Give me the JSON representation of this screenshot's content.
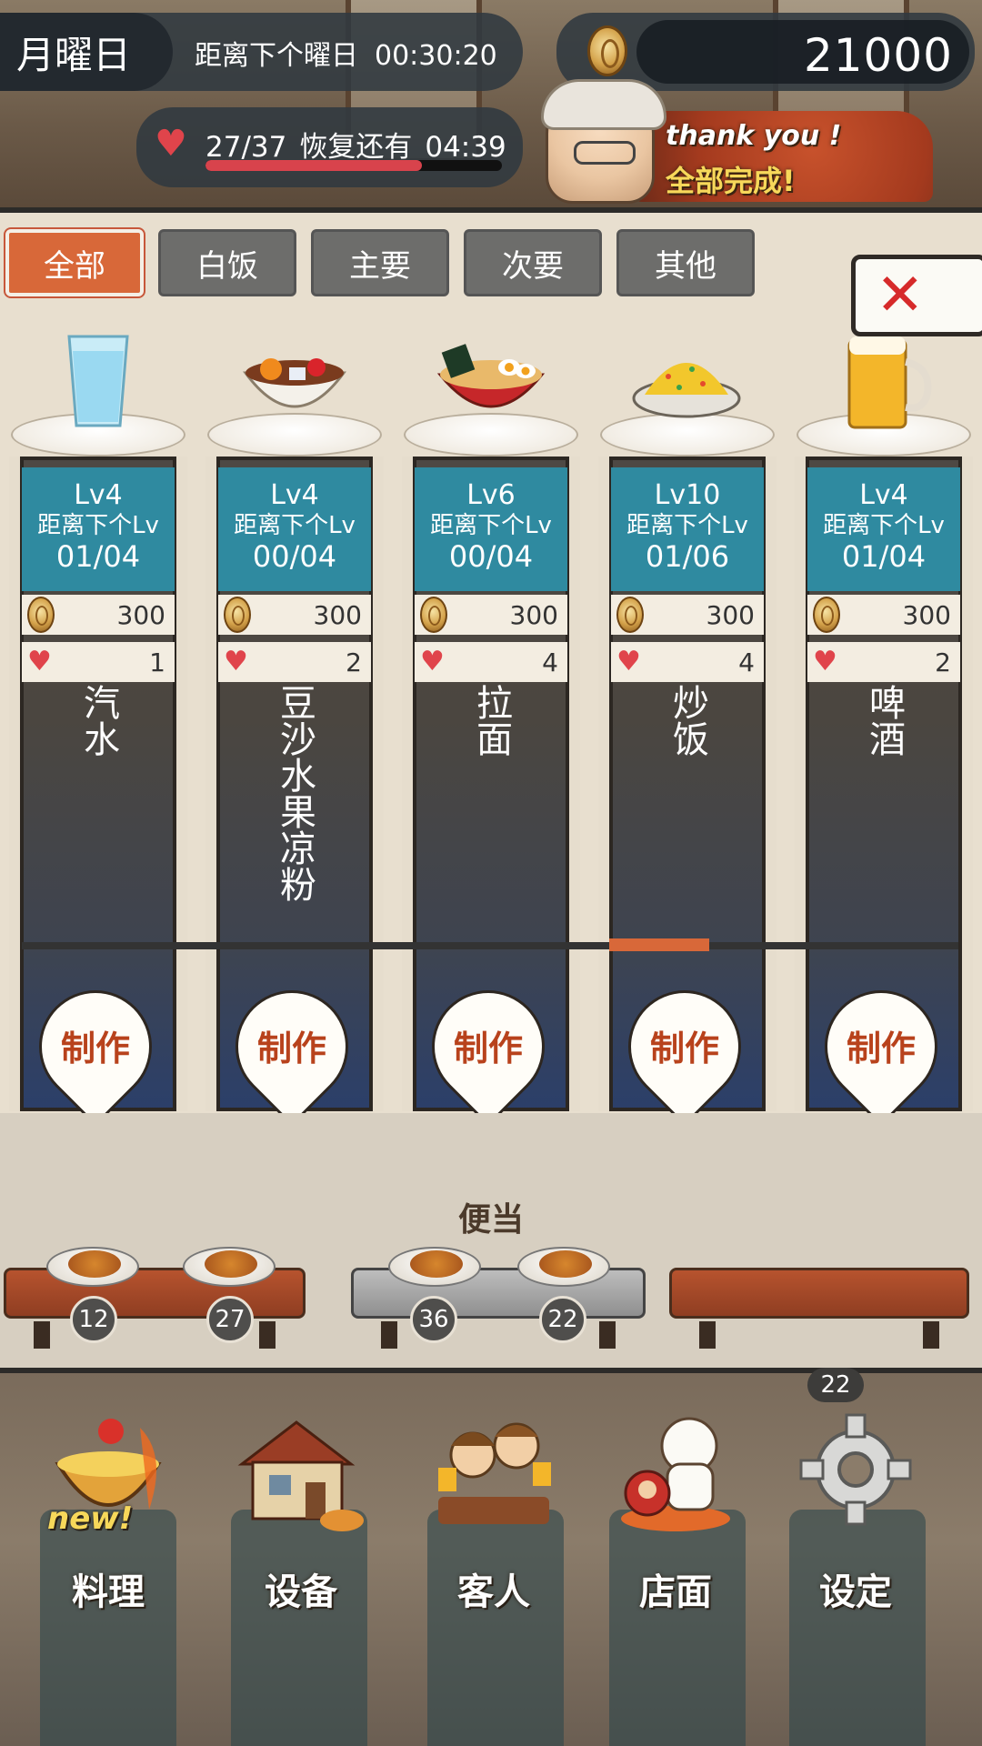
{
  "header": {
    "day": "月曜日",
    "next_day_label": "距离下个曜日",
    "next_day_timer": "00:30:20",
    "coins": "21000",
    "stamina": "27/37",
    "recover_label": "恢复还有",
    "recover_timer": "04:39",
    "stamina_fill": 0.73,
    "banner_thanks": "thank you !",
    "banner_done": "全部完成!"
  },
  "tabs": [
    "全部",
    "白饭",
    "主要",
    "次要",
    "其他"
  ],
  "active_tab": "全部",
  "dishes": [
    {
      "level": "Lv4",
      "next_label": "距离下个Lv",
      "progress": "01/04",
      "cost": "300",
      "hearts": "1",
      "name": "汽水",
      "make": "制作",
      "icon": "soda-glass-icon"
    },
    {
      "level": "Lv4",
      "next_label": "距离下个Lv",
      "progress": "00/04",
      "cost": "300",
      "hearts": "2",
      "name": "豆沙水果凉粉",
      "make": "制作",
      "icon": "fruit-jelly-bowl-icon"
    },
    {
      "level": "Lv6",
      "next_label": "距离下个Lv",
      "progress": "00/04",
      "cost": "300",
      "hearts": "4",
      "name": "拉面",
      "make": "制作",
      "icon": "ramen-bowl-icon"
    },
    {
      "level": "Lv10",
      "next_label": "距离下个Lv",
      "progress": "01/06",
      "cost": "300",
      "hearts": "4",
      "name": "炒饭",
      "make": "制作",
      "icon": "fried-rice-icon"
    },
    {
      "level": "Lv4",
      "next_label": "距离下个Lv",
      "progress": "01/04",
      "cost": "300",
      "hearts": "2",
      "name": "啤酒",
      "make": "制作",
      "icon": "beer-mug-icon"
    }
  ],
  "bento": {
    "title": "便当",
    "counts": [
      "12",
      "27",
      "36",
      "22"
    ]
  },
  "nav": {
    "items": [
      "料理",
      "设备",
      "客人",
      "店面",
      "设定"
    ],
    "new_tag": "new!",
    "settings_badge": "22"
  },
  "colors": {
    "accent": "#d86839",
    "level_bg": "#2f8aa0",
    "heart": "#e0444b"
  }
}
